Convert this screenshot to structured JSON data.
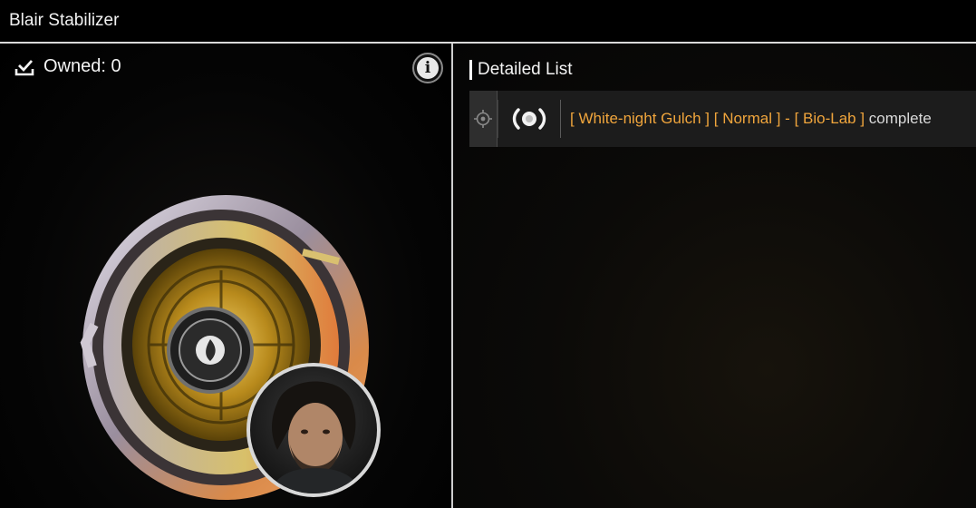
{
  "window": {
    "title": "Blair Stabilizer"
  },
  "item": {
    "owned_label": "Owned: 0",
    "info_glyph": "i",
    "icons": {
      "owned": "checkbox-download-icon",
      "info": "info-icon",
      "target": "crosshair-icon",
      "source": "signal-broadcast-icon"
    },
    "art": {
      "name": "stabilizer-module",
      "portrait": "character-portrait"
    }
  },
  "detail": {
    "header": "Detailed List",
    "rows": [
      {
        "open_1": "[ ",
        "area": "White-night Gulch",
        "close_1": " ]",
        "open_2": " [ ",
        "difficulty": "Normal",
        "close_2": " ]",
        "sep": " - ",
        "open_3": "[ ",
        "stage": "Bio-Lab",
        "close_3": " ]",
        "status": " complete"
      }
    ]
  },
  "colors": {
    "highlight": "#f0a53c",
    "text": "#f4f4f4",
    "divider": "#cfcfcf",
    "row_bg": "#1c1c1c"
  }
}
